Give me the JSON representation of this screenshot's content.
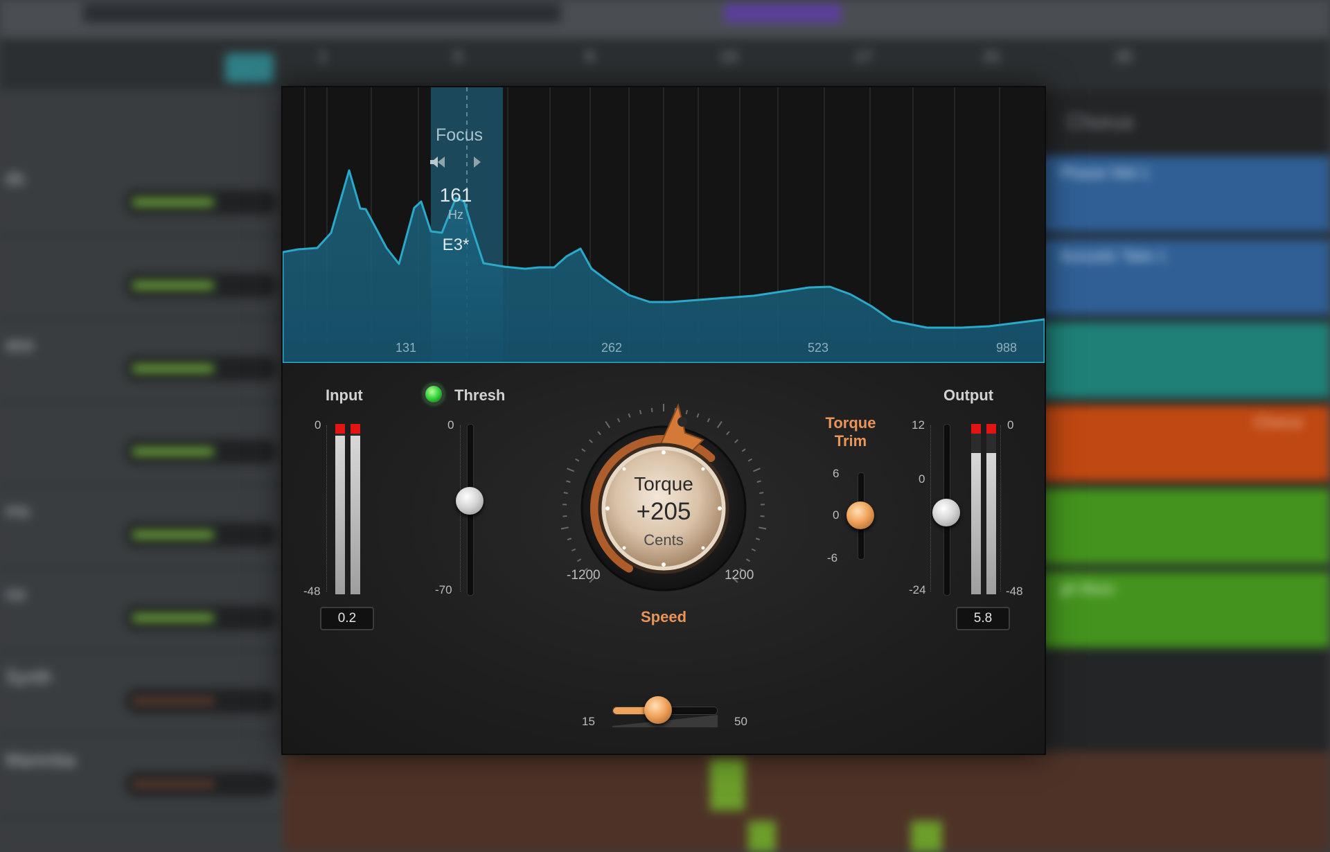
{
  "analyzer": {
    "focus_label": "Focus",
    "focus_freq": "161",
    "focus_unit": "Hz",
    "focus_note": "E3*",
    "freq_labels": [
      "131",
      "262",
      "523",
      "988"
    ]
  },
  "input": {
    "label": "Input",
    "scale_top": "0",
    "scale_bottom": "-48",
    "value": "0.2"
  },
  "thresh": {
    "label": "Thresh",
    "enabled": true,
    "scale_top": "0",
    "scale_bottom": "-70",
    "level": 0.53
  },
  "torque": {
    "title": "Torque",
    "value": "+205",
    "unit": "Cents",
    "min_label": "-1200",
    "max_label": "1200",
    "amount": 205,
    "range": [
      -1200,
      1200
    ]
  },
  "torque_trim": {
    "label_line1": "Torque",
    "label_line2": "Trim",
    "scale_top": "6",
    "scale_mid": "0",
    "scale_bottom": "-6",
    "level": 0
  },
  "output": {
    "label": "Output",
    "gain_scale_top": "12",
    "gain_scale_mid": "0",
    "gain_scale_bottom": "-24",
    "meter_scale_top": "0",
    "meter_scale_bottom": "-48",
    "value": "5.8",
    "gain_level": 0.0
  },
  "speed": {
    "label": "Speed",
    "min_label": "15",
    "max_label": "50",
    "value": 0.44
  },
  "background": {
    "ruler_ticks": [
      "1",
      "5",
      "9",
      "13",
      "17",
      "21",
      "25"
    ],
    "track_names": [
      "ds",
      "",
      "ass",
      "",
      "ms",
      "no",
      "Synth",
      "Marimba"
    ],
    "section_label": "Chorus",
    "clip_names": [
      "Phaser Mel 1",
      "Acoustic Take 1",
      "",
      "Chorus",
      "",
      "gh Bass"
    ]
  },
  "colors": {
    "accent": "#e8955a",
    "spectrum": "#2aa9c9",
    "focus_band": "#1f5f78",
    "clip_red": "#e21414"
  }
}
